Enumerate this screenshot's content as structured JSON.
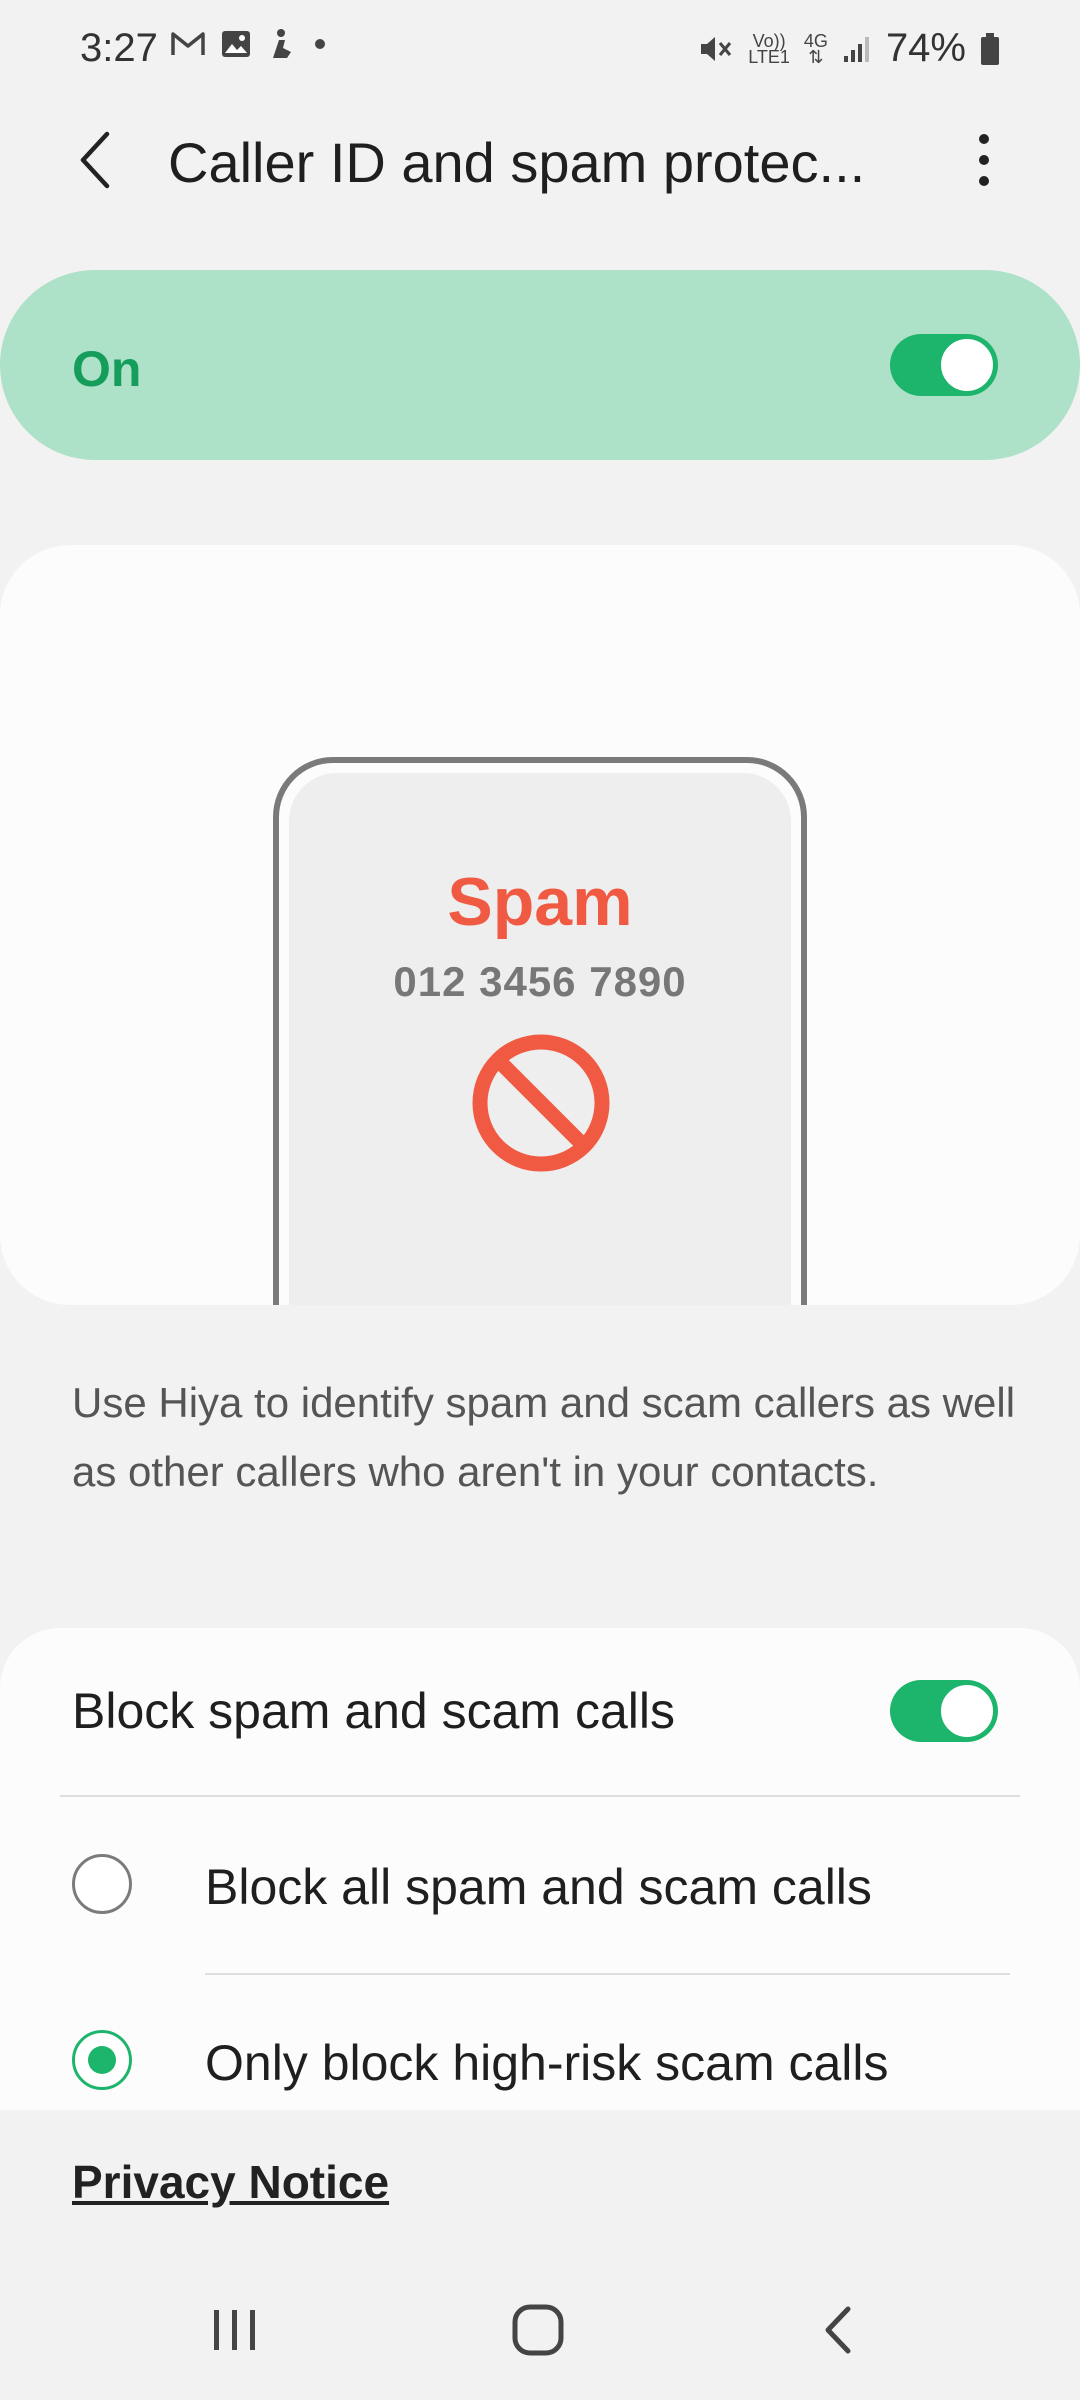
{
  "status_bar": {
    "time": "3:27",
    "left_icons": [
      "gmail-icon",
      "gallery-icon",
      "accessibility-icon",
      "dot-icon"
    ],
    "volte_top": "Vo))",
    "volte_bottom": "LTE1",
    "network_type": "4G",
    "battery_percent": "74%"
  },
  "app_bar": {
    "title": "Caller ID and spam protec...",
    "back_icon": "back-arrow-icon",
    "more_icon": "more-vert-icon"
  },
  "master_switch": {
    "label": "On",
    "enabled": true
  },
  "illustration": {
    "spam_label": "Spam",
    "phone_number": "012 3456 7890"
  },
  "description": "Use Hiya to identify spam and scam callers as well as other callers who aren't in your contacts.",
  "settings": {
    "block_toggle_label": "Block spam and scam calls",
    "block_toggle_enabled": true,
    "options": [
      {
        "label": "Block all spam and scam calls",
        "selected": false
      },
      {
        "label": "Only block high-risk scam calls",
        "selected": true
      }
    ]
  },
  "footer": {
    "privacy_link": "Privacy Notice"
  },
  "colors": {
    "accent": "#1db46b",
    "master_bg": "#ade1c8",
    "spam_red": "#f05a42"
  }
}
